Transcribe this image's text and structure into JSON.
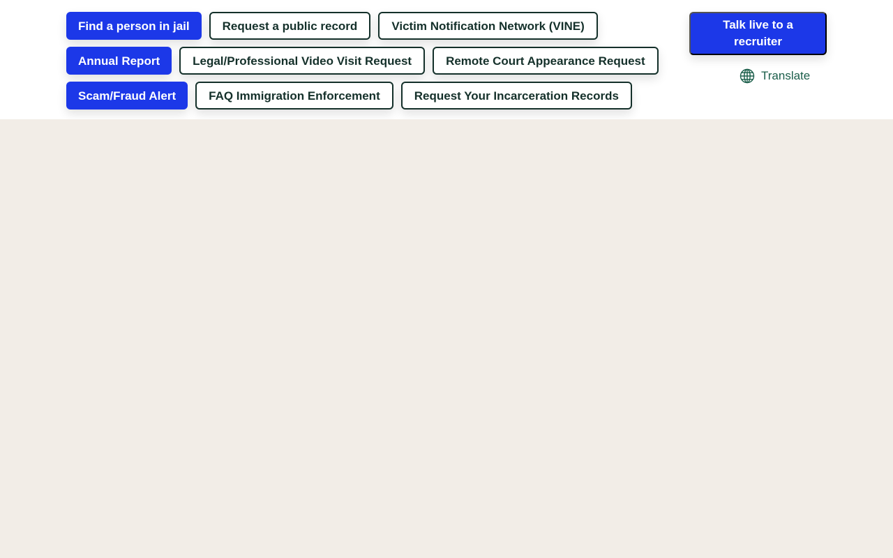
{
  "quick_links": {
    "rows": [
      [
        {
          "label": "Find a person in jail",
          "style": "primary"
        },
        {
          "label": "Request a public record",
          "style": "outline"
        },
        {
          "label": "Victim Notification Network (VINE)",
          "style": "outline"
        }
      ],
      [
        {
          "label": "Annual Report",
          "style": "primary"
        },
        {
          "label": "Legal/Professional Video Visit Request",
          "style": "outline"
        },
        {
          "label": "Remote Court Appearance Request",
          "style": "outline"
        }
      ],
      [
        {
          "label": "Scam/Fraud Alert",
          "style": "primary"
        },
        {
          "label": "FAQ Immigration Enforcement",
          "style": "outline"
        },
        {
          "label": "Request Your Incarceration Records",
          "style": "outline"
        }
      ]
    ]
  },
  "recruiter_button": {
    "label": "Talk live to a recruiter"
  },
  "translate": {
    "label": "Translate",
    "icon": "globe-icon"
  },
  "colors": {
    "primary_button": "#1c38e8",
    "outline_border": "#14302a",
    "translate_text": "#1b5e4a",
    "page_background": "#f2ede7",
    "header_background": "#ffffff"
  }
}
